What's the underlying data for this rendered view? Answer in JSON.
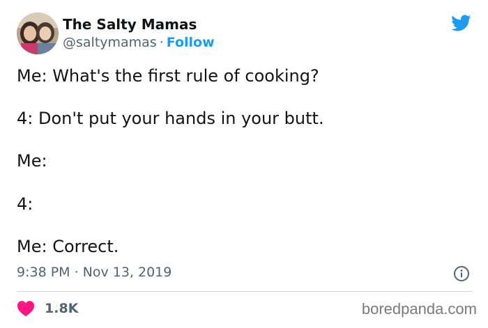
{
  "author": {
    "display_name": "The Salty Mamas",
    "handle": "@saltymamas",
    "separator": "·",
    "follow_label": "Follow"
  },
  "tweet": {
    "lines": [
      "Me: What's the first rule of cooking?",
      "4: Don't put your hands in your butt.",
      "Me:",
      "4:",
      "Me: Correct."
    ],
    "time": "9:38 PM",
    "separator": "·",
    "date": "Nov 13, 2019",
    "like_count": "1.8K"
  },
  "icons": {
    "brand": "twitter-bird-icon",
    "info": "info-icon",
    "like": "heart-icon"
  },
  "colors": {
    "accent": "#1d9bf0",
    "like": "#f91880",
    "muted": "#536471",
    "text": "#0f1419",
    "divider": "#cfd9de"
  },
  "watermark": "boredpanda.com"
}
